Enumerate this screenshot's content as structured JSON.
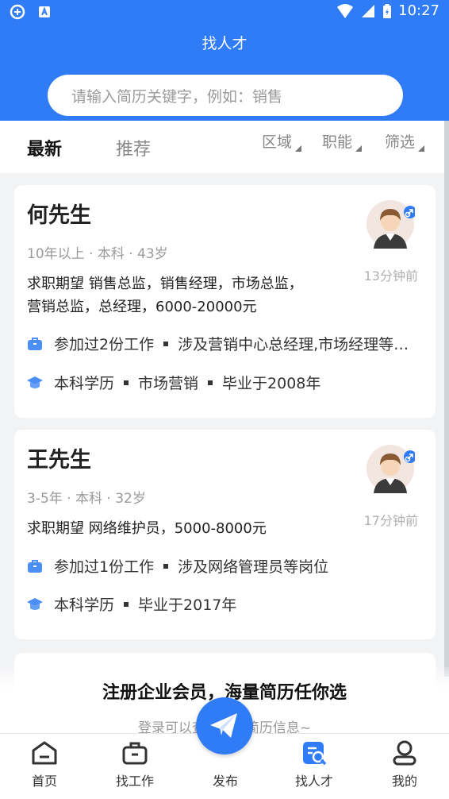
{
  "status": {
    "time": "10:27"
  },
  "header": {
    "title": "找人才",
    "search_placeholder": "请输入简历关键字，例如：销售"
  },
  "tabs": [
    {
      "label": "最新"
    },
    {
      "label": "推荐"
    }
  ],
  "filters": [
    {
      "label": "区域"
    },
    {
      "label": "职能"
    },
    {
      "label": "筛选"
    }
  ],
  "cards": [
    {
      "name": "何先生",
      "meta": "10年以上 · 本科 · 43岁",
      "ago": "13分钟前",
      "expect_line1": "求职期望 销售总监，销售经理，市场总监，",
      "expect_line2": "营销总监，总经理，6000-20000元",
      "work_a": "参加过2份工作",
      "work_b": "涉及营销中心总经理,市场经理等…",
      "edu_a": "本科学历",
      "edu_b": "市场营销",
      "edu_c": "毕业于2008年"
    },
    {
      "name": "王先生",
      "meta": "3-5年 · 本科 · 32岁",
      "ago": "17分钟前",
      "expect_line1": "求职期望 网络维护员，5000-8000元",
      "work_a": "参加过1份工作",
      "work_b": "涉及网络管理员等岗位",
      "edu_a": "本科学历",
      "edu_b": "毕业于2017年"
    }
  ],
  "promo": {
    "title": "注册企业会员，海量简历任你选",
    "sub": "登录可以查看更多简历信息~"
  },
  "nav": [
    {
      "label": "首页",
      "icon": "home-icon"
    },
    {
      "label": "找工作",
      "icon": "briefcase-icon"
    },
    {
      "label": "发布",
      "icon": "send-icon"
    },
    {
      "label": "找人才",
      "icon": "talent-search-icon"
    },
    {
      "label": "我的",
      "icon": "user-icon"
    }
  ],
  "colors": {
    "brand": "#2f7cf6",
    "male_badge": "#2f7cf6"
  }
}
